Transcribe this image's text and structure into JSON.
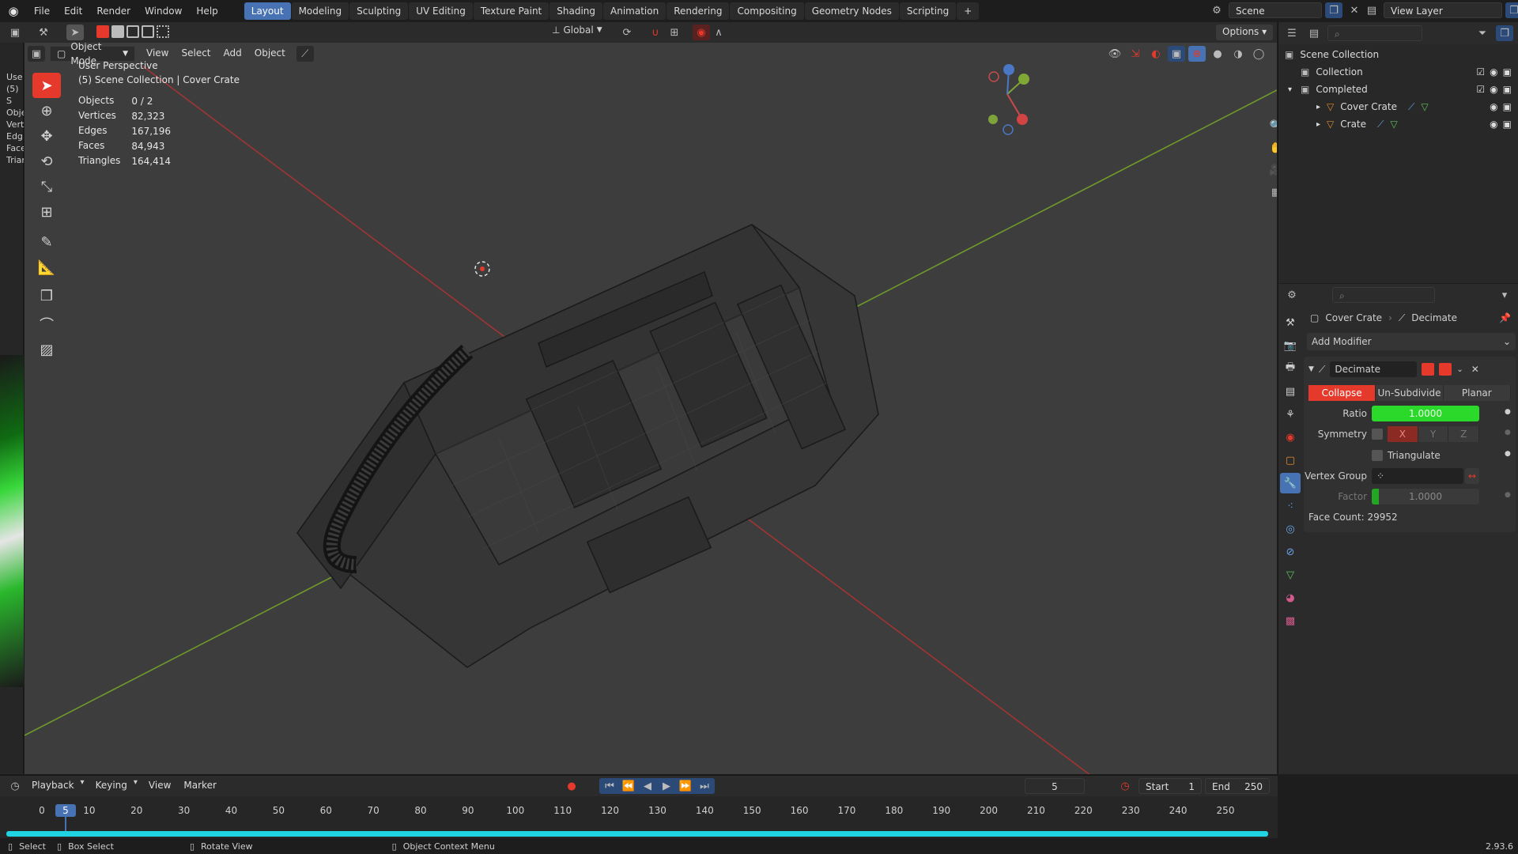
{
  "topbar": {
    "menus": [
      "File",
      "Edit",
      "Render",
      "Window",
      "Help"
    ],
    "workspaces": [
      "Layout",
      "Modeling",
      "Sculpting",
      "UV Editing",
      "Texture Paint",
      "Shading",
      "Animation",
      "Rendering",
      "Compositing",
      "Geometry Nodes",
      "Scripting"
    ],
    "active_workspace": "Layout",
    "add_tab": "+",
    "scene_name": "Scene",
    "view_layer_name": "View Layer"
  },
  "tool_header": {
    "orientation": "Global",
    "options_label": "Options"
  },
  "viewport_header": {
    "mode": "Object Mode",
    "menus": [
      "View",
      "Select",
      "Add",
      "Object"
    ]
  },
  "viewport": {
    "perspective_label": "User Perspective",
    "collection_label": "(5) Scene Collection | Cover Crate",
    "stats": [
      {
        "label": "Objects",
        "value": "0 / 2"
      },
      {
        "label": "Vertices",
        "value": "82,323"
      },
      {
        "label": "Edges",
        "value": "167,196"
      },
      {
        "label": "Faces",
        "value": "84,943"
      },
      {
        "label": "Triangles",
        "value": "164,414"
      }
    ],
    "left_clip_text": [
      "Use",
      "(5) S",
      "Obje",
      "Vert",
      "Edg",
      "Face",
      "Triar"
    ]
  },
  "outliner": {
    "items": [
      {
        "label": "Scene Collection",
        "indent": 0,
        "checkbox": false
      },
      {
        "label": "Collection",
        "indent": 1,
        "checkbox": true
      },
      {
        "label": "Completed",
        "indent": 1,
        "checkbox": true
      },
      {
        "label": "Cover Crate",
        "indent": 2,
        "checkbox": false
      },
      {
        "label": "Crate",
        "indent": 2,
        "checkbox": false
      }
    ]
  },
  "properties": {
    "object_name": "Cover Crate",
    "modifier_breadcrumb": "Decimate",
    "add_modifier": "Add Modifier",
    "modifier": {
      "name": "Decimate",
      "modes": [
        "Collapse",
        "Un-Subdivide",
        "Planar"
      ],
      "active_mode": "Collapse",
      "ratio_label": "Ratio",
      "ratio_value": "1.0000",
      "symmetry_label": "Symmetry",
      "axes": [
        "X",
        "Y",
        "Z"
      ],
      "triangulate_label": "Triangulate",
      "vertex_group_label": "Vertex Group",
      "factor_label": "Factor",
      "factor_value": "1.0000",
      "face_count": "Face Count: 29952"
    }
  },
  "timeline": {
    "menus": [
      "Playback",
      "Keying",
      "View",
      "Marker"
    ],
    "current_frame": "5",
    "start_label": "Start",
    "start_value": "1",
    "end_label": "End",
    "end_value": "250",
    "ticks": [
      "0",
      "10",
      "20",
      "30",
      "40",
      "50",
      "60",
      "70",
      "80",
      "90",
      "100",
      "110",
      "120",
      "130",
      "140",
      "150",
      "160",
      "170",
      "180",
      "190",
      "200",
      "210",
      "220",
      "230",
      "240",
      "250"
    ],
    "playhead_label": "5"
  },
  "statusbar": {
    "select": "Select",
    "box_select": "Box Select",
    "rotate_view": "Rotate View",
    "context_menu": "Object Context Menu",
    "version": "2.93.6"
  },
  "colors": {
    "accent": "#4772b3",
    "active_red": "#e4392b",
    "ratio_green": "#2bd92b",
    "timeline_cyan": "#1fd3e3",
    "x_axis": "#b03a3a",
    "y_axis": "#6e9a2a"
  }
}
